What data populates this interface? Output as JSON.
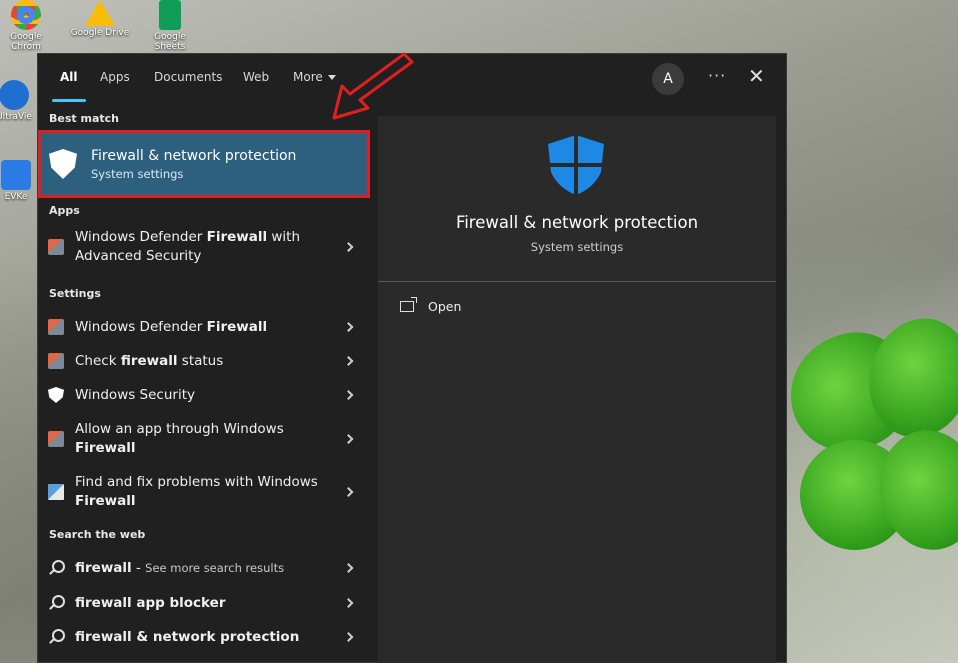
{
  "desktop": {
    "icons": [
      {
        "name": "Google Chrome",
        "label": "Google Chrom"
      },
      {
        "name": "Google Drive",
        "label": "Google Drive"
      },
      {
        "name": "Google Sheets",
        "label": "Google Sheets"
      },
      {
        "name": "UltraViewer",
        "label": "UltraVie"
      },
      {
        "name": "EVKey",
        "label": "EVKe"
      }
    ]
  },
  "tabs": {
    "all": "All",
    "apps": "Apps",
    "documents": "Documents",
    "web": "Web",
    "more": "More"
  },
  "header": {
    "avatar_letter": "A",
    "more_options": "···",
    "close": "✕"
  },
  "sections": {
    "best_match": "Best match",
    "apps": "Apps",
    "settings": "Settings",
    "search_web": "Search the web"
  },
  "best_match": {
    "title": "Firewall & network protection",
    "subtitle": "System settings"
  },
  "apps": [
    {
      "pre": "Windows Defender ",
      "bold": "Firewall",
      "post": " with Advanced Security"
    }
  ],
  "settings": [
    {
      "pre": "Windows Defender ",
      "bold": "Firewall",
      "post": ""
    },
    {
      "pre": "Check ",
      "bold": "firewall",
      "post": " status"
    },
    {
      "pre": "Windows Security",
      "bold": "",
      "post": ""
    },
    {
      "pre": "Allow an app through Windows ",
      "bold": "Firewall",
      "post": ""
    },
    {
      "pre": "Find and fix problems with Windows ",
      "bold": "Firewall",
      "post": ""
    }
  ],
  "web": [
    {
      "bold": "firewall",
      "post": " - ",
      "sub": "See more search results"
    },
    {
      "bold": "firewall app blocker",
      "post": "",
      "sub": ""
    },
    {
      "bold": "firewall & network protection",
      "post": "",
      "sub": ""
    }
  ],
  "preview": {
    "title": "Firewall & network protection",
    "subtitle": "System settings",
    "open_label": "Open"
  },
  "colors": {
    "accent": "#4cc2ff",
    "selection": "#2d5f7f",
    "highlight_box": "#e02020",
    "shield_blue": "#1e88e5"
  }
}
